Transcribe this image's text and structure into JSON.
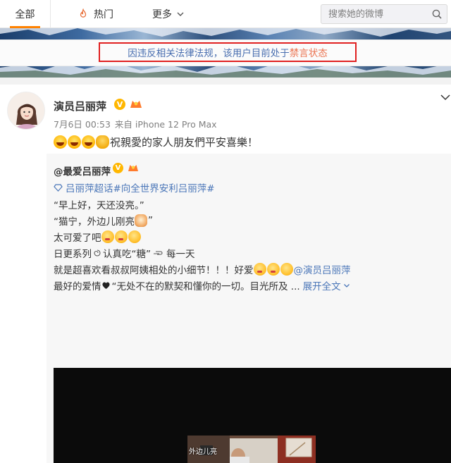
{
  "nav": {
    "tab_all": "全部",
    "tab_hot": "热门",
    "tab_more": "更多",
    "search_placeholder": "搜索她的微博"
  },
  "notice": {
    "prefix": "因违反相关法律法规，该用户目前处于",
    "link": "禁言状态"
  },
  "post": {
    "username": "演员吕丽萍",
    "verified_badge": "V",
    "date": "7月6日 00:53",
    "source": "来自 iPhone 12 Pro Max",
    "text": "祝親愛的家人朋友們平安喜樂！",
    "emoji": [
      "laugh",
      "laugh",
      "laugh",
      "pray"
    ]
  },
  "repost": {
    "author": "@最爱吕丽萍",
    "topic": "吕丽萍超话#向全世界安利吕丽萍#",
    "line1": "“早上好，天还没亮。”",
    "line2": "“猫宁，外边儿刚亮",
    "line2_end": "”",
    "line3": "太可爱了吧",
    "line4_a": "日更系列",
    "line4_b": "认真吃“糖”",
    "line4_c": "每一天",
    "line5": "就是超喜欢看叔叔阿姨相处的小细节！！！好爱",
    "line5_mention": "@演员吕丽萍",
    "line6": "最好的爱情",
    "line6_b": "“无处不在的默契和懂你的一切。目光所及 ...",
    "expand": "展开全文",
    "video_caption": "外边儿亮"
  },
  "colors": {
    "accent_orange": "#ff8200",
    "link_blue": "#4a76b8",
    "highlight_red": "#e02020"
  }
}
